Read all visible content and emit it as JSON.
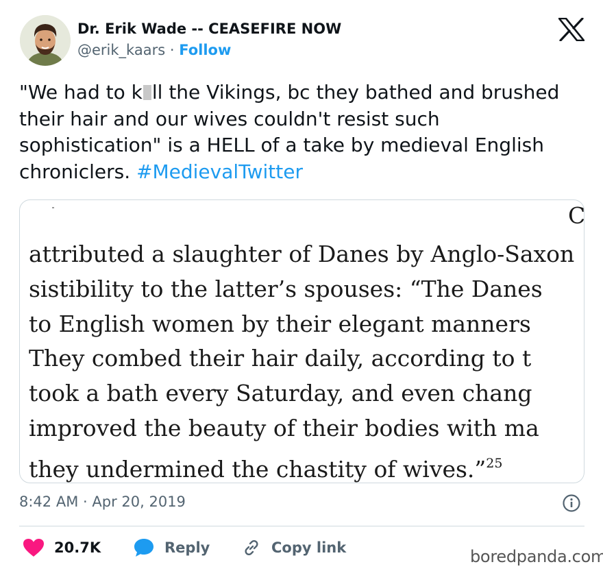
{
  "author": {
    "name": "Dr. Erik Wade -- CEASEFIRE NOW",
    "handle": "@erik_kaars",
    "separator": "·",
    "follow_label": "Follow",
    "avatar_icon": "cartoon-avatar"
  },
  "tweet": {
    "text_before": "\"We had to k",
    "text_after": "ll the Vikings, bc they bathed and brushed their hair and our wives couldn't resist such sophistication\" is a HELL of a take by medieval English chroniclers. ",
    "hashtag": "#MedievalTwitter"
  },
  "media": {
    "corner_letter": "C",
    "lines": [
      "attributed a slaughter of Danes by Anglo-Saxon",
      "sistibility to the latter’s spouses: “The Danes",
      "to English women by their elegant manners",
      "They combed their hair daily, according to t",
      "took a bath every Saturday, and even chang",
      "improved the beauty of their bodies with ma"
    ],
    "last_line": "they undermined the chastity of wives.”",
    "footnote": "25"
  },
  "meta": {
    "time": "8:42 AM",
    "separator": "·",
    "date": "Apr 20, 2019"
  },
  "actions": {
    "likes_count": "20.7K",
    "reply_label": "Reply",
    "copy_link_label": "Copy link"
  },
  "watermark": "boredpanda.com",
  "colors": {
    "accent": "#1d9bf0",
    "heart": "#f91880",
    "text": "#0f1419",
    "muted": "#536471"
  }
}
